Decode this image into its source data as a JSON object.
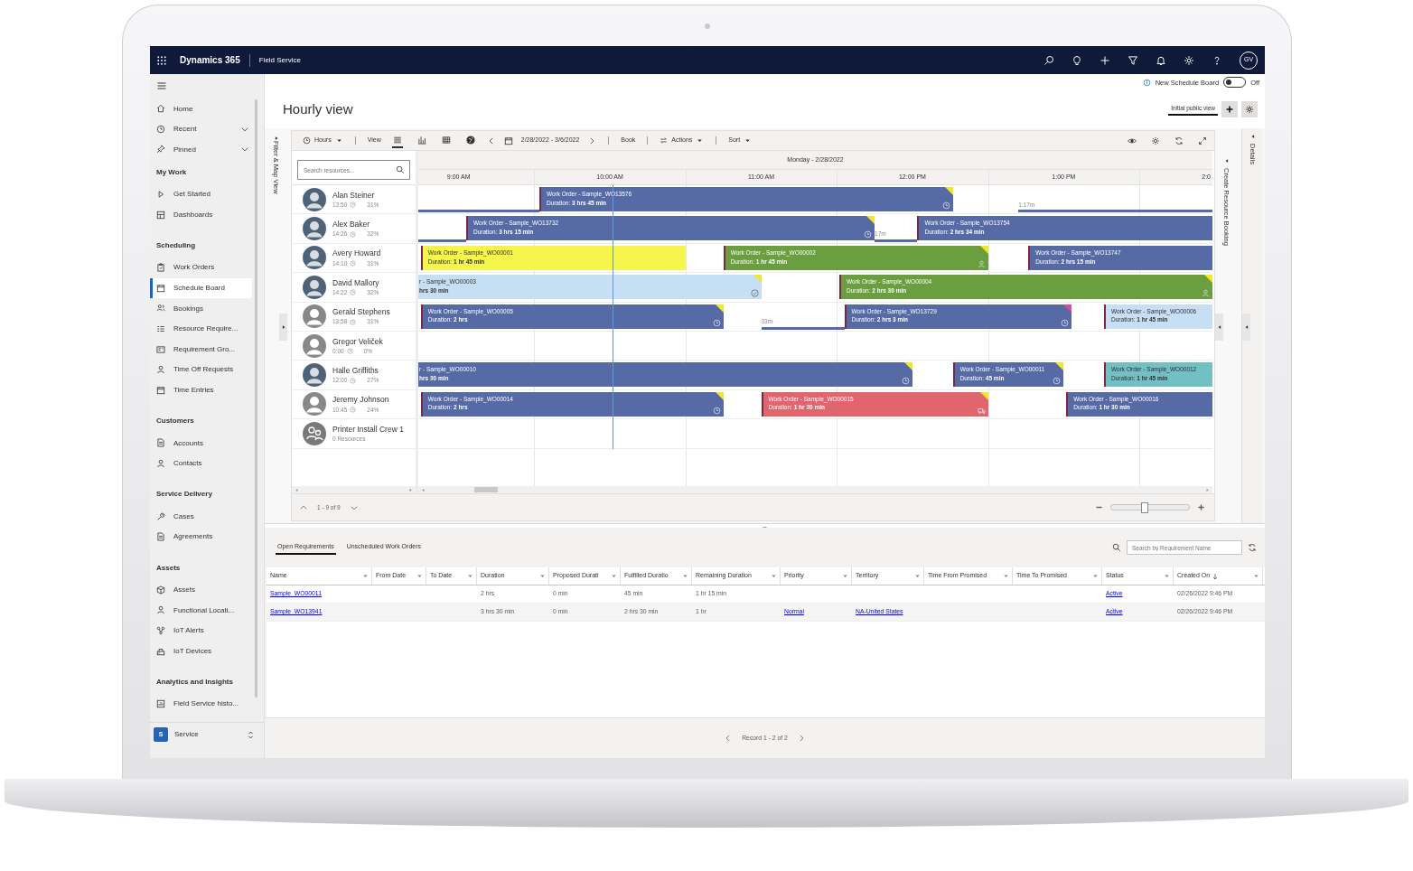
{
  "app_bar": {
    "brand": "Dynamics 365",
    "app": "Field Service",
    "avatar": "GV"
  },
  "sidebar": {
    "groups": [
      {
        "items": [
          {
            "label": "Home",
            "selected": false,
            "expandable": false
          },
          {
            "label": "Recent",
            "selected": false,
            "expandable": true
          },
          {
            "label": "Pinned",
            "selected": false,
            "expandable": true
          }
        ]
      },
      {
        "title": "My Work",
        "items": [
          {
            "label": "Get Started",
            "selected": false
          },
          {
            "label": "Dashboards",
            "selected": false
          }
        ]
      },
      {
        "title": "Scheduling",
        "items": [
          {
            "label": "Work Orders",
            "selected": false
          },
          {
            "label": "Schedule Board",
            "selected": true
          },
          {
            "label": "Bookings",
            "selected": false
          },
          {
            "label": "Resource Require...",
            "selected": false
          },
          {
            "label": "Requirement Gro...",
            "selected": false
          },
          {
            "label": "Time Off Requests",
            "selected": false
          },
          {
            "label": "Time Entries",
            "selected": false
          }
        ]
      },
      {
        "title": "Customers",
        "items": [
          {
            "label": "Accounts",
            "selected": false
          },
          {
            "label": "Contacts",
            "selected": false
          }
        ]
      },
      {
        "title": "Service Delivery",
        "items": [
          {
            "label": "Cases",
            "selected": false
          },
          {
            "label": "Agreements",
            "selected": false
          }
        ]
      },
      {
        "title": "Assets",
        "items": [
          {
            "label": "Assets",
            "selected": false
          },
          {
            "label": "Functional Locati...",
            "selected": false
          },
          {
            "label": "IoT Alerts",
            "selected": false
          },
          {
            "label": "IoT Devices",
            "selected": false
          }
        ]
      },
      {
        "title": "Analytics and Insights",
        "items": [
          {
            "label": "Field Service histo...",
            "selected": false
          }
        ]
      }
    ],
    "area": {
      "badge": "S",
      "label": "Service"
    }
  },
  "header": {
    "info_label": "New Schedule Board",
    "toggle_on": false,
    "toggle_label": "Off",
    "title": "Hourly view",
    "view_tab": "Initial public view"
  },
  "board": {
    "side_tab": "Filter & Map View",
    "toolbar": {
      "hours": "Hours",
      "view": "View",
      "view_modes": [
        {
          "selected": true
        },
        {
          "selected": false
        },
        {
          "selected": false
        },
        {
          "selected": false
        }
      ],
      "date_range": "2/28/2022 - 3/6/2022",
      "book": "Book",
      "actions": "Actions",
      "sort": "Sort"
    },
    "search_placeholder": "Search resources...",
    "day": "Monday - 2/28/2022",
    "hours": [
      "9:00 AM",
      "10:00 AM",
      "11:00 AM",
      "12:00 PM",
      "1:00 PM",
      "2:0"
    ],
    "resources": [
      {
        "name": "Alan Steiner",
        "kind": "person",
        "photo": true,
        "time": "13:50",
        "utilization": "31%",
        "items": [
          {
            "kind": "travel"
          },
          {
            "kind": "scheduled",
            "title": "Work Order - Sample_WO13576",
            "duration": "Duration: **3 hrs 45 min**",
            "color": "#566aa6",
            "flag": {
              "color": "#f0e62a"
            }
          },
          {
            "kind": "travel",
            "label": "1:17m"
          }
        ]
      },
      {
        "name": "Alex Baker",
        "kind": "person",
        "photo": true,
        "time": "14:26",
        "utilization": "32%",
        "items": [
          {
            "kind": "travel"
          },
          {
            "kind": "scheduled",
            "title": "Work Order - Sample_WO13732",
            "duration": "Duration: **3 hrs 15 min**",
            "color": "#566aa6",
            "flag": {
              "color": "#f0e62a"
            }
          },
          {
            "kind": "travel",
            "label": "17m"
          },
          {
            "kind": "booking",
            "title": "Work Order - Sample_WO13754",
            "duration": "Duration: **2 hrs 34 min**",
            "color": "#566aa6"
          }
        ]
      },
      {
        "name": "Avery Howard",
        "kind": "person",
        "photo": true,
        "time": "14:10",
        "utilization": "31%",
        "items": [
          {
            "kind": "booking",
            "title": "Work Order - Sample_WO00001",
            "duration": "Duration: **1 hr 45 min**",
            "color": "#f5f54c"
          },
          {
            "kind": "started",
            "title": "Work Order - Sample_WO00002",
            "duration": "Duration: **1 hr 45 min**",
            "color": "#6a9e3f",
            "flag": {
              "color": "#f0e62a"
            }
          },
          {
            "kind": "booking",
            "title": "Work Order - Sample_WO13747",
            "duration": "Duration: **2 hrs 15 min**",
            "color": "#566aa6"
          }
        ]
      },
      {
        "name": "David Mallory",
        "kind": "person",
        "photo": true,
        "time": "14:22",
        "utilization": "32%",
        "items": [
          {
            "kind": "completed",
            "title": "r - Sample_WO00003",
            "duration": "**hrs 30 min**",
            "color": "#c7dff4",
            "flag": {
              "color": "#f0e62a"
            }
          },
          {
            "kind": "started",
            "title": "Work Order - Sample_WO00004",
            "duration": "Duration: **2 hrs 30 min**",
            "color": "#6a9e3f",
            "flag": {
              "color": "#f0e62a"
            }
          }
        ]
      },
      {
        "name": "Gerald Stephens",
        "kind": "person",
        "photo": false,
        "time": "13:58",
        "utilization": "31%",
        "items": [
          {
            "kind": "scheduled",
            "title": "Work Order - Sample_WO00005",
            "duration": "Duration: **2 hrs**",
            "color": "#566aa6",
            "flag": {
              "color": "#f0e62a"
            }
          },
          {
            "kind": "travel",
            "label": "33m"
          },
          {
            "kind": "scheduled",
            "title": "Work Order - Sample_WO13729",
            "duration": "Duration: **2 hrs 3 min**",
            "color": "#566aa6",
            "flag": {
              "color": "#e8439a"
            }
          },
          {
            "kind": "booking",
            "title": "Work Order - Sample_WO00006",
            "duration": "Duration: **1 hr 45 min**",
            "color": "#c7dff4"
          }
        ]
      },
      {
        "name": "Gregor Veliček",
        "kind": "person",
        "photo": false,
        "time": "0:00",
        "utilization": "0%"
      },
      {
        "name": "Halle Griffiths",
        "kind": "person",
        "photo": true,
        "time": "12:00",
        "utilization": "27%",
        "items": [
          {
            "kind": "scheduled",
            "title": "r - Sample_WO00010",
            "duration": "**hrs 30 min**",
            "color": "#566aa6",
            "flag": {
              "color": "#f0e62a"
            }
          },
          {
            "kind": "scheduled",
            "title": "Work Order - Sample_WO00011",
            "duration": "Duration: **45 min**",
            "color": "#566aa6",
            "flag": {
              "color": "#f0e62a"
            }
          },
          {
            "kind": "booking",
            "title": "Work Order - Sample_WO00012",
            "duration": "Duration: **1 hr 45 min**",
            "color": "#72bfc4"
          }
        ]
      },
      {
        "name": "Jeremy Johnson",
        "kind": "person",
        "photo": false,
        "time": "10:45",
        "utilization": "24%",
        "items": [
          {
            "kind": "scheduled",
            "title": "Work Order - Sample_WO00014",
            "duration": "Duration: **2 hrs**",
            "color": "#566aa6",
            "flag": {
              "color": "#f0e62a"
            }
          },
          {
            "kind": "traveling",
            "title": "Work Order - Sample_WO00015",
            "duration": "Duration: **1 hr 30 min**",
            "color": "#e0656d",
            "flag": {
              "color": "#f0e62a"
            }
          },
          {
            "kind": "booking",
            "title": "Work Order - Sample_WO00016",
            "duration": "Duration: **1 hr 30 min**",
            "color": "#566aa6"
          }
        ]
      },
      {
        "name": "Printer Install Crew 1",
        "kind": "crew",
        "detail": "0 Resources"
      }
    ],
    "pager": "1 - 9 of 9",
    "zoom": {
      "level": 0.43
    },
    "booking_tab": "Create Resource Booking",
    "details_tab": "Details"
  },
  "requirements": {
    "tabs": [
      {
        "label": "Open Requirements",
        "selected": true
      },
      {
        "label": "Unscheduled Work Orders",
        "selected": false
      }
    ],
    "search_placeholder": "Search by Requirement Name",
    "columns": [
      {
        "label": "Name",
        "sorted": false
      },
      {
        "label": "From Date",
        "sorted": false
      },
      {
        "label": "To Date",
        "sorted": false
      },
      {
        "label": "Duration",
        "sorted": false
      },
      {
        "label": "Proposed Durati",
        "sorted": false
      },
      {
        "label": "Fulfilled Duratio",
        "sorted": false
      },
      {
        "label": "Remaining Duration",
        "sorted": false
      },
      {
        "label": "Priority",
        "sorted": false
      },
      {
        "label": "Territory",
        "sorted": false
      },
      {
        "label": "Time From Promised",
        "sorted": false
      },
      {
        "label": "Time To Promised",
        "sorted": false
      },
      {
        "label": "Status",
        "sorted": false
      },
      {
        "label": "Created On",
        "sorted": true
      }
    ],
    "rows": [
      {
        "cells": [
          {
            "text": "Sample_WO00011",
            "link": true
          },
          {},
          {},
          {
            "text": "2 hrs",
            "link": false
          },
          {
            "text": "0 min",
            "link": false
          },
          {
            "text": "45 min",
            "link": false
          },
          {
            "text": "1 hr 15 min",
            "link": false
          },
          {},
          {},
          {},
          {},
          {
            "text": "Active",
            "link": true
          },
          {
            "text": "02/26/2022 9:46 PM",
            "link": false
          }
        ]
      },
      {
        "cells": [
          {
            "text": "Sample_WO13941",
            "link": true
          },
          {},
          {},
          {
            "text": "3 hrs 30 min",
            "link": false
          },
          {
            "text": "0 min",
            "link": false
          },
          {
            "text": "2 hrs 30 min",
            "link": false
          },
          {
            "text": "1 hr",
            "link": false
          },
          {
            "text": "Normal",
            "link": true
          },
          {
            "text": "NA-United States",
            "link": true
          },
          {},
          {},
          {
            "text": "Active",
            "link": true
          },
          {
            "text": "02/26/2022 9:46 PM",
            "link": false
          }
        ]
      }
    ],
    "pager": "Record 1 - 2 of 2"
  }
}
